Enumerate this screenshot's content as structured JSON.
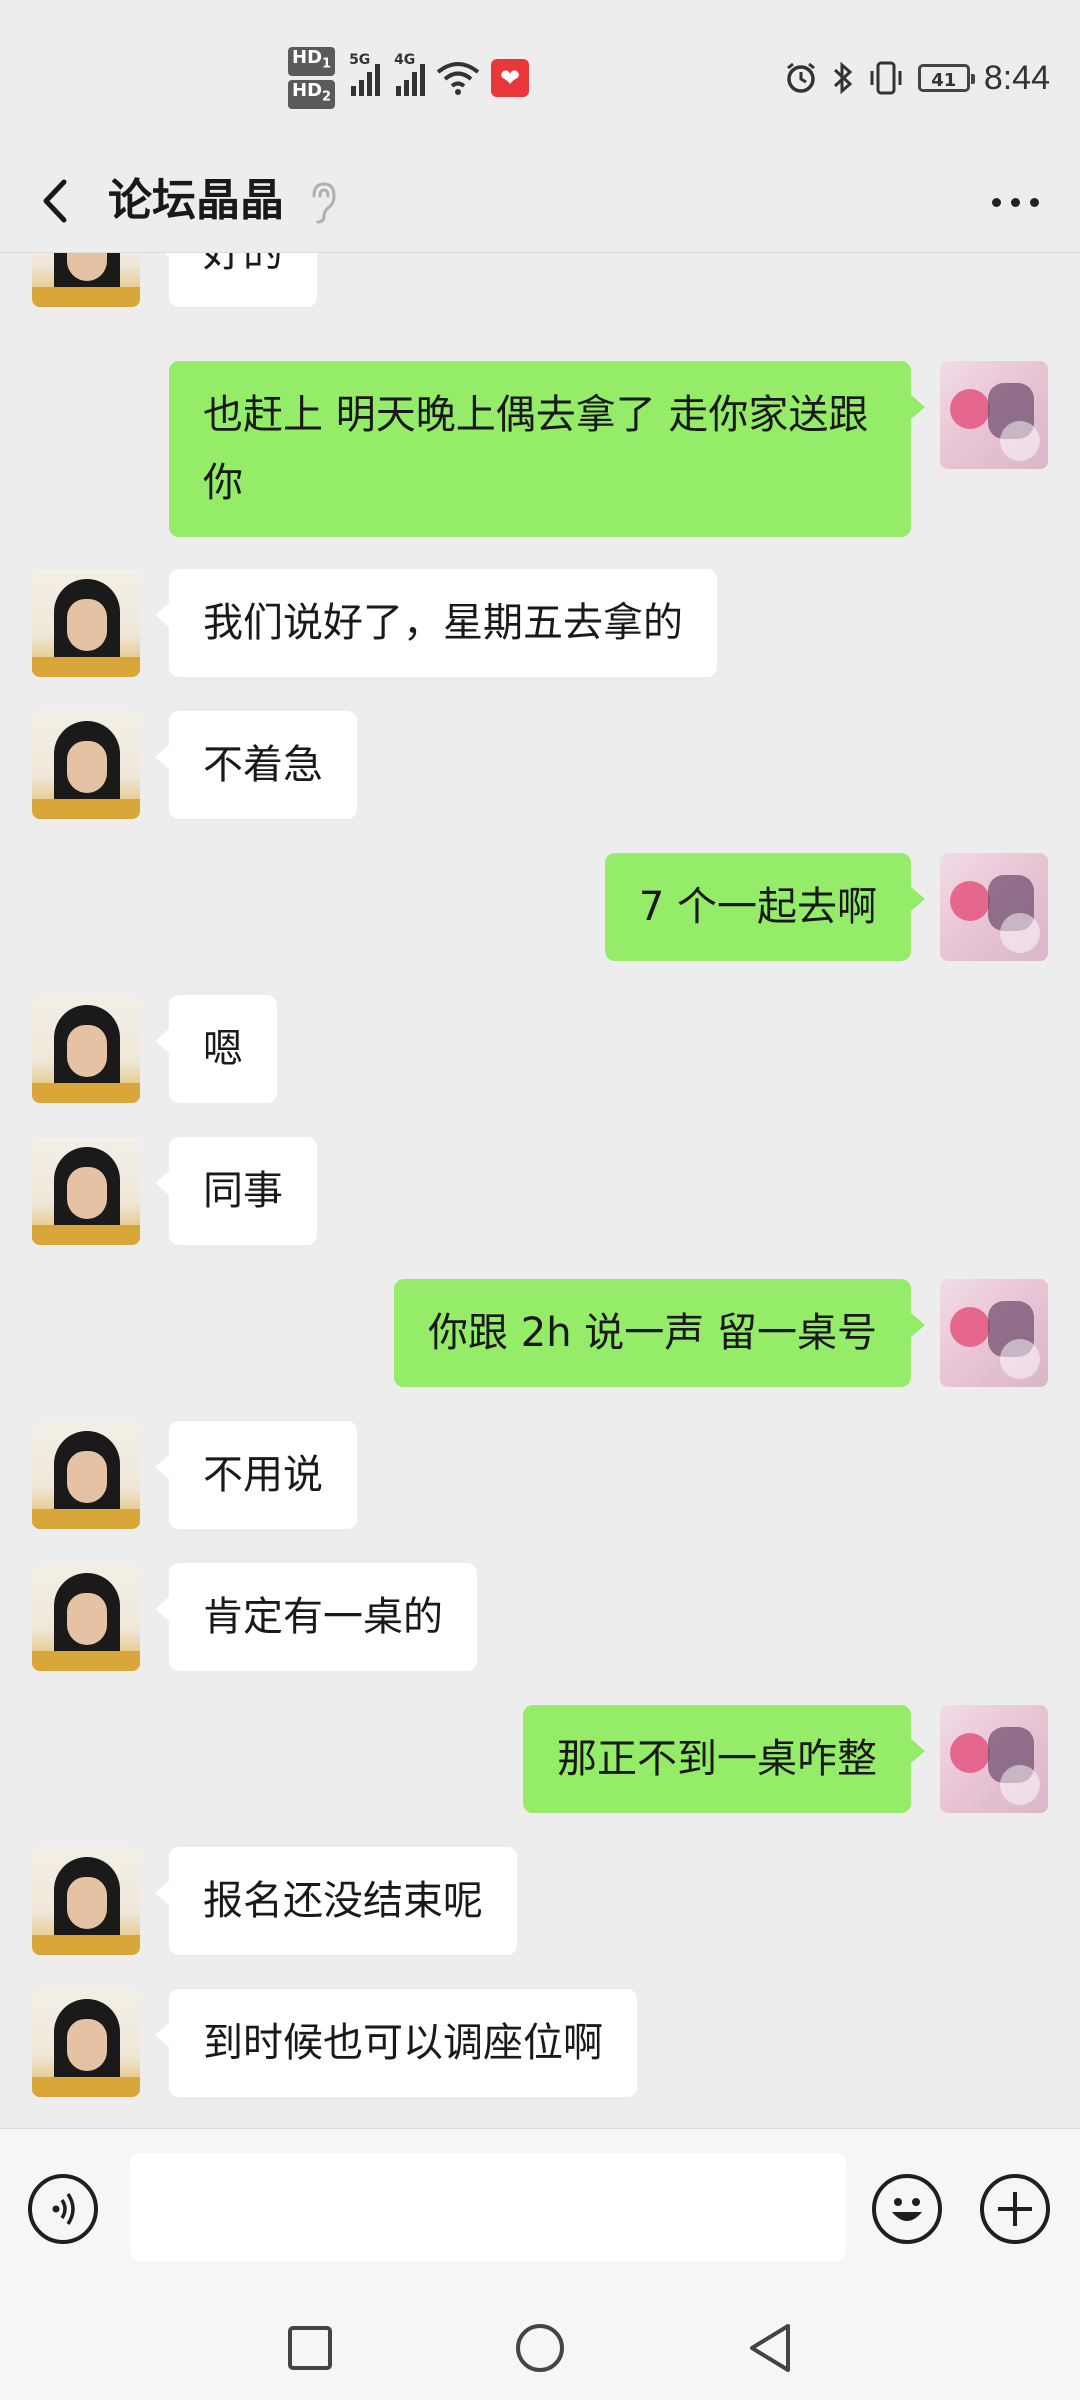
{
  "status_bar": {
    "time": "8:44",
    "battery": "41",
    "hd1": "HD",
    "hd1_sub": "1",
    "hd2": "HD",
    "hd2_sub": "2",
    "net1": "5G",
    "net2": "4G",
    "icons": [
      "signal-icon",
      "wifi-icon",
      "huawei-health-icon",
      "alarm-icon",
      "bluetooth-icon",
      "vibrate-icon",
      "battery-icon"
    ]
  },
  "header": {
    "title": "论坛晶晶",
    "back_icon": "chevron-left-icon",
    "ear_icon": "earpiece-mode-icon",
    "more_icon": "more-horizontal-icon"
  },
  "messages": [
    {
      "side": "left",
      "text": "好的"
    },
    {
      "side": "right",
      "text": "也赶上  明天晚上偶去拿了  走你家送跟你"
    },
    {
      "side": "left",
      "text": "我们说好了，星期五去拿的"
    },
    {
      "side": "left",
      "text": "不着急"
    },
    {
      "side": "right",
      "text": "7 个一起去啊"
    },
    {
      "side": "left",
      "text": "嗯"
    },
    {
      "side": "left",
      "text": "同事"
    },
    {
      "side": "right",
      "text": "你跟 2h 说一声  留一桌号"
    },
    {
      "side": "left",
      "text": "不用说"
    },
    {
      "side": "left",
      "text": "肯定有一桌的"
    },
    {
      "side": "right",
      "text": "那正不到一桌咋整"
    },
    {
      "side": "left",
      "text": "报名还没结束呢"
    },
    {
      "side": "left",
      "text": "到时候也可以调座位啊"
    }
  ],
  "input_bar": {
    "value": "",
    "voice_icon": "voice-input-icon",
    "emoji_icon": "emoji-icon",
    "plus_icon": "plus-icon"
  },
  "nav_bar": {
    "icons": [
      "recent-apps-square-icon",
      "home-circle-icon",
      "back-triangle-icon"
    ]
  },
  "colors": {
    "background": "#ededed",
    "sent_bubble": "#95ec69",
    "received_bubble": "#ffffff",
    "text": "#191919"
  }
}
